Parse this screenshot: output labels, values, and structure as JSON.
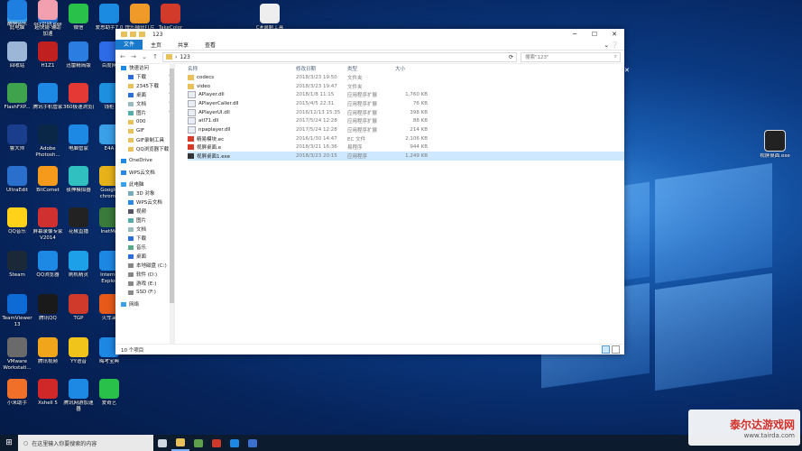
{
  "desktop": {
    "icons": [
      {
        "label": "此电脑",
        "color": "#3aa0e8"
      },
      {
        "label": "超快捷·辅助\n加速",
        "color": "#1b6fd0"
      },
      {
        "label": "微信",
        "color": "#2ac14a"
      },
      {
        "label": "爱思助手7.0",
        "color": "#1a8be0"
      },
      {
        "label": "快乐捕获打片",
        "color": "#f09a2a"
      },
      {
        "label": "TakeColor",
        "color": "#d23a2a"
      },
      {
        "label": "回收站",
        "color": "#9bb6d6"
      },
      {
        "label": "H1Z1",
        "color": "#c02020"
      },
      {
        "label": "迅雷精简版",
        "color": "#2b7de2"
      },
      {
        "label": "百度网",
        "color": "#2e6be6"
      },
      {
        "label": "FlashFXP...",
        "color": "#3fa34d"
      },
      {
        "label": "腾讯手机管家",
        "color": "#1e88e5"
      },
      {
        "label": "360极速浏览器",
        "color": "#e53935"
      },
      {
        "label": "钱柜",
        "color": "#1e90e0"
      },
      {
        "label": "鲁大师",
        "color": "#1a3e8c"
      },
      {
        "label": "Adobe\nPhotosh...",
        "color": "#0a2748"
      },
      {
        "label": "电脑管家",
        "color": "#1e88e5"
      },
      {
        "label": "E4A",
        "color": "#3aa0e8"
      },
      {
        "label": "UltraEdit",
        "color": "#2a6fcc"
      },
      {
        "label": "BitComet",
        "color": "#f59a1b"
      },
      {
        "label": "夜神模拟器",
        "color": "#30c0c0"
      },
      {
        "label": "Google\nchrome",
        "color": "#e8b31a"
      },
      {
        "label": "QQ音乐",
        "color": "#ffd21a"
      },
      {
        "label": "屏幕录像专家\nV2014",
        "color": "#d03030"
      },
      {
        "label": "花椒直播",
        "color": "#222"
      },
      {
        "label": "InetMg",
        "color": "#3a7a3a"
      },
      {
        "label": "Steam",
        "color": "#1b2838"
      },
      {
        "label": "QQ浏览器",
        "color": "#1e88e5"
      },
      {
        "label": "刷机精灵",
        "color": "#1ea0e8"
      },
      {
        "label": "Interne\nExplor",
        "color": "#1e88e5"
      },
      {
        "label": "TeamViewer\n13",
        "color": "#0e6bd6"
      },
      {
        "label": "腾讯QQ",
        "color": "#1a1a1a"
      },
      {
        "label": "TGP",
        "color": "#d03a2a"
      },
      {
        "label": "火车采",
        "color": "#e85a1a"
      },
      {
        "label": "VMware\nWorkstati...",
        "color": "#6a6a6a"
      },
      {
        "label": "腾讯视频",
        "color": "#f0a51a"
      },
      {
        "label": "YY语音",
        "color": "#f0c41a"
      },
      {
        "label": "晦考宝典",
        "color": "#1e88e5"
      },
      {
        "label": "小米助手",
        "color": "#f0702a"
      },
      {
        "label": "Xshell 5",
        "color": "#d02828"
      },
      {
        "label": "腾讯网游加速\n器",
        "color": "#1e88e5"
      },
      {
        "label": "爱奇艺",
        "color": "#2ac14a"
      },
      {
        "label": "酷狗音乐",
        "color": "#1e7fe0"
      },
      {
        "label": "ocr识别.exe",
        "color": "#f2a0b0"
      }
    ],
    "right_icons": [
      {
        "label": "C#录制工具"
      },
      {
        "label": "视屏桌面.exe"
      }
    ]
  },
  "window": {
    "title": "123",
    "tabs": [
      "文件",
      "主页",
      "共享",
      "查看"
    ],
    "path": "123",
    "search_placeholder": "搜索\"123\"",
    "columns": {
      "name": "名称",
      "date": "修改日期",
      "type": "类型",
      "size": "大小"
    },
    "files": [
      {
        "name": "codecs",
        "date": "2018/3/23 19:50",
        "type": "文件夹",
        "size": "",
        "icon": "folder"
      },
      {
        "name": "video",
        "date": "2018/3/23 19:47",
        "type": "文件夹",
        "size": "",
        "icon": "folder"
      },
      {
        "name": "APlayer.dll",
        "date": "2018/1/8 11:15",
        "type": "应用程序扩展",
        "size": "1,760 KB",
        "icon": "dll"
      },
      {
        "name": "APlayerCaller.dll",
        "date": "2015/4/5 22:31",
        "type": "应用程序扩展",
        "size": "76 KB",
        "icon": "dll"
      },
      {
        "name": "APlayerUI.dll",
        "date": "2016/12/13 15:35",
        "type": "应用程序扩展",
        "size": "398 KB",
        "icon": "dll"
      },
      {
        "name": "atl71.dll",
        "date": "2017/5/24 12:28",
        "type": "应用程序扩展",
        "size": "88 KB",
        "icon": "dll"
      },
      {
        "name": "npaplayer.dll",
        "date": "2017/5/24 12:28",
        "type": "应用程序扩展",
        "size": "214 KB",
        "icon": "dll"
      },
      {
        "name": "精易模块.ec",
        "date": "2016/1/30 14:47",
        "type": "EC 文件",
        "size": "2,106 KB",
        "icon": "ec"
      },
      {
        "name": "视屏桌面.e",
        "date": "2018/3/21 16:36",
        "type": "易程序",
        "size": "944 KB",
        "icon": "e"
      },
      {
        "name": "视屏桌面1.exe",
        "date": "2018/3/23 20:15",
        "type": "应用程序",
        "size": "1,249 KB",
        "icon": "exe",
        "selected": true
      }
    ],
    "nav": [
      {
        "label": "快速访问",
        "pin": false,
        "indent": 0,
        "icon": "#1e88e5"
      },
      {
        "label": "下载",
        "pin": true,
        "indent": 1,
        "icon": "#2b6fd6"
      },
      {
        "label": "2345下载",
        "pin": true,
        "indent": 1,
        "icon": "#e8c15a"
      },
      {
        "label": "桌面",
        "pin": true,
        "indent": 1,
        "icon": "#2b6fd6"
      },
      {
        "label": "文档",
        "pin": true,
        "indent": 1,
        "icon": "#9bb"
      },
      {
        "label": "图片",
        "pin": true,
        "indent": 1,
        "icon": "#5aa"
      },
      {
        "label": "000",
        "pin": false,
        "indent": 1,
        "icon": "#e8c15a"
      },
      {
        "label": "GIF",
        "pin": false,
        "indent": 1,
        "icon": "#e8c15a"
      },
      {
        "label": "GIF录制工具",
        "pin": false,
        "indent": 1,
        "icon": "#e8c15a"
      },
      {
        "label": "QQ浏览器下载",
        "pin": false,
        "indent": 1,
        "icon": "#e8c15a"
      },
      {
        "label": "",
        "pin": false,
        "indent": 0,
        "icon": ""
      },
      {
        "label": "OneDrive",
        "pin": false,
        "indent": 0,
        "icon": "#1e88e5"
      },
      {
        "label": "",
        "pin": false,
        "indent": 0,
        "icon": ""
      },
      {
        "label": "WPS云文档",
        "pin": false,
        "indent": 0,
        "icon": "#2b88e5"
      },
      {
        "label": "",
        "pin": false,
        "indent": 0,
        "icon": ""
      },
      {
        "label": "此电脑",
        "pin": false,
        "indent": 0,
        "icon": "#3aa0e8"
      },
      {
        "label": "3D 对象",
        "pin": false,
        "indent": 1,
        "icon": "#7ab"
      },
      {
        "label": "WPS云文档",
        "pin": false,
        "indent": 1,
        "icon": "#2b88e5"
      },
      {
        "label": "视频",
        "pin": false,
        "indent": 1,
        "icon": "#556"
      },
      {
        "label": "图片",
        "pin": false,
        "indent": 1,
        "icon": "#5aa"
      },
      {
        "label": "文档",
        "pin": false,
        "indent": 1,
        "icon": "#9bb"
      },
      {
        "label": "下载",
        "pin": false,
        "indent": 1,
        "icon": "#2b6fd6"
      },
      {
        "label": "音乐",
        "pin": false,
        "indent": 1,
        "icon": "#5a8"
      },
      {
        "label": "桌面",
        "pin": false,
        "indent": 1,
        "icon": "#2b6fd6"
      },
      {
        "label": "本地磁盘 (C:)",
        "pin": false,
        "indent": 1,
        "icon": "#888"
      },
      {
        "label": "软件 (D:)",
        "pin": false,
        "indent": 1,
        "icon": "#888"
      },
      {
        "label": "游戏 (E:)",
        "pin": false,
        "indent": 1,
        "icon": "#888"
      },
      {
        "label": "SSD (F:)",
        "pin": false,
        "indent": 1,
        "icon": "#888"
      },
      {
        "label": "",
        "pin": false,
        "indent": 0,
        "icon": ""
      },
      {
        "label": "网络",
        "pin": false,
        "indent": 0,
        "icon": "#3aa0e8"
      }
    ],
    "status": "10 个项目"
  },
  "taskbar": {
    "search_placeholder": "在这里输入你要搜索的内容",
    "items": [
      {
        "name": "task-view",
        "color": "#cfd8e3",
        "active": false
      },
      {
        "name": "file-explorer",
        "color": "#e8c15a",
        "active": true
      },
      {
        "name": "app-2",
        "color": "#5fa04a",
        "active": false
      },
      {
        "name": "app-3",
        "color": "#d03a2a",
        "active": false
      },
      {
        "name": "qq-browser",
        "color": "#1e88e5",
        "active": false
      },
      {
        "name": "app-5",
        "color": "#3a6fd0",
        "active": false
      }
    ]
  },
  "watermark": {
    "title": "泰尔达游戏网",
    "url": "www.tairda.com"
  }
}
